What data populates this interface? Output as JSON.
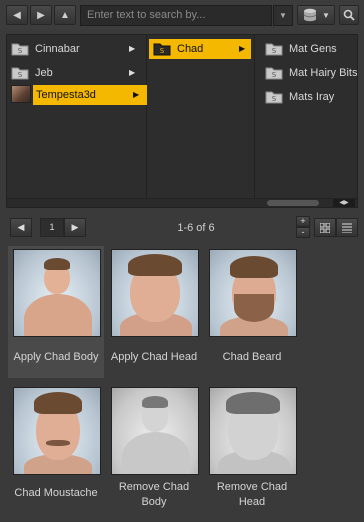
{
  "toolbar": {
    "back_icon": "◀",
    "forward_icon": "▶",
    "up_icon": "▲",
    "search_placeholder": "Enter text to search by...",
    "dropdown_icon": "▼",
    "db_icon": "database-icon",
    "search_icon": "search-icon"
  },
  "tree": {
    "col1": [
      {
        "label": "Cinnabar"
      },
      {
        "label": "Jeb"
      },
      {
        "label": "Tempesta3d"
      }
    ],
    "col2": [
      {
        "label": "Chad"
      }
    ],
    "col3": [
      {
        "label": "Mat Gens"
      },
      {
        "label": "Mat Hairy Bits"
      },
      {
        "label": "Mats Iray"
      }
    ],
    "arrow": "▶"
  },
  "pager": {
    "prev": "◀",
    "page": "1",
    "next": "▶",
    "count": "1-6 of 6",
    "plus": "+",
    "minus": "-"
  },
  "items": [
    {
      "caption": "Apply Chad Body"
    },
    {
      "caption": "Apply Chad Head"
    },
    {
      "caption": "Chad Beard"
    },
    {
      "caption": "Chad Moustache"
    },
    {
      "caption": "Remove Chad Body"
    },
    {
      "caption": "Remove Chad Head"
    }
  ],
  "colors": {
    "selection": "#f5b800",
    "background": "#3a3a3a",
    "panel": "#2d2d2d"
  }
}
